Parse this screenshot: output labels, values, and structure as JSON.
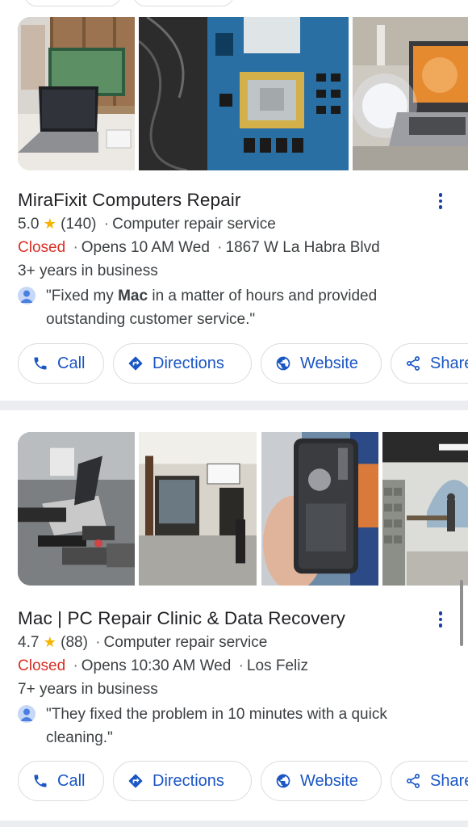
{
  "results": [
    {
      "name": "MiraFixit Computers Repair",
      "rating": "5.0",
      "star": "★",
      "reviews": "(140)",
      "category": "Computer repair service",
      "status": "Closed",
      "hours": "Opens 10 AM Wed",
      "location": "1867 W La Habra Blvd",
      "years": "3+ years in business",
      "review_pre": "\"Fixed my ",
      "review_bold": "Mac",
      "review_post": " in a matter of hours and provided outstanding customer service.\"",
      "buttons": {
        "call": "Call",
        "directions": "Directions",
        "website": "Website",
        "share": "Share"
      }
    },
    {
      "name": "Mac | PC Repair Clinic & Data Recovery",
      "rating": "4.7",
      "star": "★",
      "reviews": "(88)",
      "category": "Computer repair service",
      "status": "Closed",
      "hours": "Opens 10:30 AM Wed",
      "location": "Los Feliz",
      "years": "7+ years in business",
      "review_pre": "\"They fixed the problem in 10 minutes with a quick cleaning.\"",
      "review_bold": "",
      "review_post": "",
      "buttons": {
        "call": "Call",
        "directions": "Directions",
        "website": "Website",
        "share": "Share"
      }
    }
  ],
  "separator": "·",
  "colors": {
    "link_blue": "#1a56c4",
    "closed_red": "#d93025",
    "star_gold": "#f5b400",
    "divider": "#ebedf0"
  },
  "icons": {
    "call": "phone-icon",
    "directions": "directions-icon",
    "website": "globe-icon",
    "share": "share-icon",
    "more": "more-vertical-icon",
    "avatar": "user-avatar-icon"
  }
}
